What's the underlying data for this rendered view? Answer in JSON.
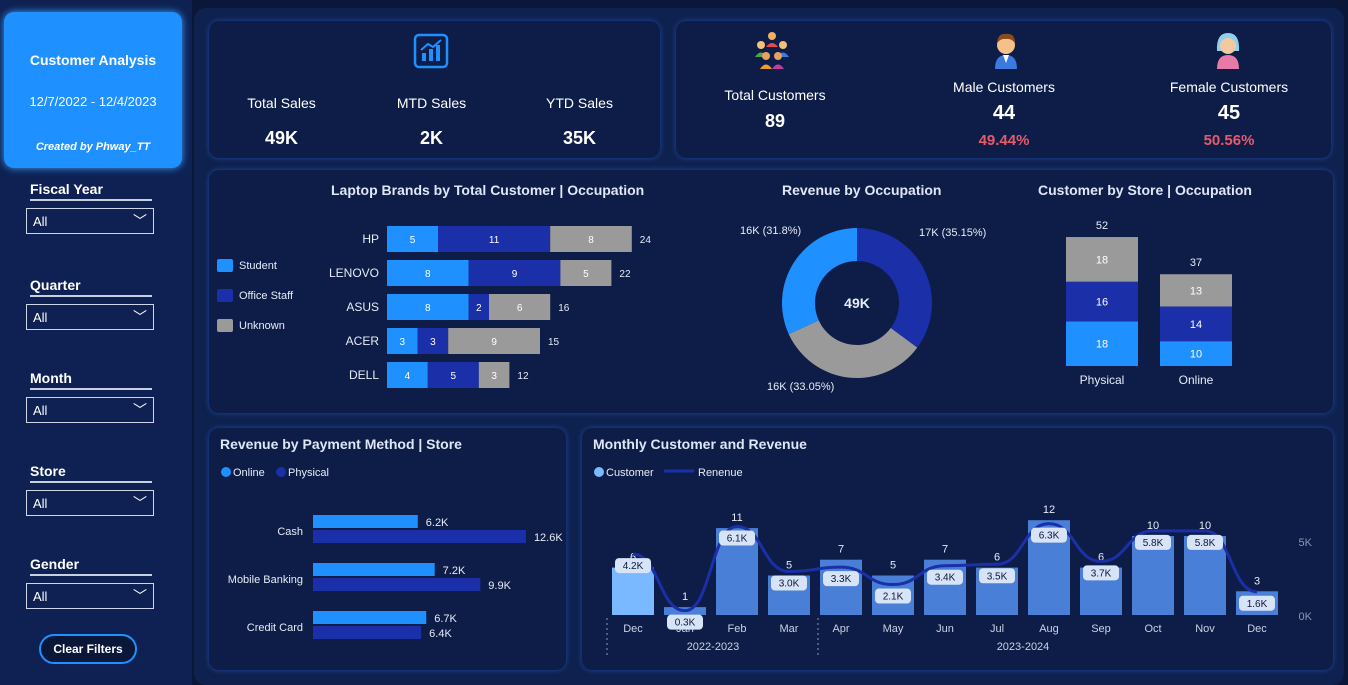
{
  "sidebar": {
    "title": "Customer Analysis",
    "date_range": "12/7/2022 - 12/4/2023",
    "created_by": "Created by Phway_TT",
    "filters": [
      {
        "label": "Fiscal Year",
        "value": "All"
      },
      {
        "label": "Quarter",
        "value": "All"
      },
      {
        "label": "Month",
        "value": "All"
      },
      {
        "label": "Store",
        "value": "All"
      },
      {
        "label": "Gender",
        "value": "All"
      }
    ],
    "clear_label": "Clear Filters"
  },
  "kpi_sales": {
    "icon": "growth-chart-icon",
    "total_label": "Total Sales",
    "total_value": "49K",
    "mtd_label": "MTD Sales",
    "mtd_value": "2K",
    "ytd_label": "YTD Sales",
    "ytd_value": "35K"
  },
  "kpi_customers": {
    "total_label": "Total Customers",
    "total_value": "89",
    "male_label": "Male Customers",
    "male_value": "44",
    "male_pct": "49.44%",
    "female_label": "Female Customers",
    "female_value": "45",
    "female_pct": "50.56%",
    "colors": {
      "pct": "#e85a6a"
    }
  },
  "colors": {
    "student": "#1e90ff",
    "office": "#1a2fa8",
    "unknown": "#9a9a9a",
    "accent": "#1e90ff"
  },
  "chart_data": [
    {
      "type": "bar",
      "title": "Laptop Brands by Total Customer | Occupation",
      "categories": [
        "HP",
        "LENOVO",
        "ASUS",
        "ACER",
        "DELL"
      ],
      "series": [
        {
          "name": "Student",
          "values": [
            5,
            8,
            8,
            3,
            4
          ]
        },
        {
          "name": "Office Staff",
          "values": [
            11,
            9,
            2,
            3,
            5
          ]
        },
        {
          "name": "Unknown",
          "values": [
            8,
            5,
            6,
            9,
            3
          ]
        }
      ],
      "totals": [
        24,
        22,
        16,
        15,
        12
      ],
      "legend": "left"
    },
    {
      "type": "pie",
      "title": "Revenue by Occupation",
      "center_label": "49K",
      "slices": [
        {
          "label": "17K (35.15%)",
          "value": 35.15,
          "color": "#1a2fa8"
        },
        {
          "label": "16K (33.05%)",
          "value": 33.05,
          "color": "#9a9a9a"
        },
        {
          "label": "16K (31.8%)",
          "value": 31.8,
          "color": "#1e90ff"
        }
      ]
    },
    {
      "type": "bar",
      "title": "Customer by Store | Occupation",
      "categories": [
        "Physical",
        "Online"
      ],
      "series": [
        {
          "name": "Student",
          "values": [
            18,
            10
          ]
        },
        {
          "name": "Office Staff",
          "values": [
            16,
            14
          ]
        },
        {
          "name": "Unknown",
          "values": [
            18,
            13
          ]
        }
      ],
      "totals": [
        52,
        37
      ]
    },
    {
      "type": "bar",
      "title": "Revenue by Payment Method | Store",
      "categories": [
        "Cash",
        "Mobile Banking",
        "Credit Card"
      ],
      "series": [
        {
          "name": "Online",
          "values": [
            6.2,
            7.2,
            6.7
          ],
          "labels": [
            "6.2K",
            "7.2K",
            "6.7K"
          ]
        },
        {
          "name": "Physical",
          "values": [
            12.6,
            9.9,
            6.4
          ],
          "labels": [
            "12.6K",
            "9.9K",
            "6.4K"
          ]
        }
      ],
      "legend": "top-left"
    },
    {
      "type": "bar",
      "title": "Monthly Customer and Revenue",
      "categories": [
        "Dec",
        "Jan",
        "Feb",
        "Mar",
        "Apr",
        "May",
        "Jun",
        "Jul",
        "Aug",
        "Sep",
        "Oct",
        "Nov",
        "Dec"
      ],
      "groups": [
        {
          "label": "2022-2023"
        },
        {
          "label": "2023-2024"
        }
      ],
      "series": [
        {
          "name": "Customer",
          "values": [
            6,
            1,
            11,
            5,
            7,
            5,
            7,
            6,
            12,
            6,
            10,
            10,
            3
          ]
        },
        {
          "name": "Renenue",
          "values": [
            4.2,
            0.3,
            6.1,
            3.0,
            3.3,
            2.1,
            3.4,
            3.5,
            6.3,
            3.7,
            5.8,
            5.8,
            1.6
          ],
          "labels": [
            "4.2K",
            "0.3K",
            "6.1K",
            "3.0K",
            "3.3K",
            "2.1K",
            "3.4K",
            "3.5K",
            "6.3K",
            "3.7K",
            "5.8K",
            "5.8K",
            "1.6K"
          ]
        }
      ],
      "y2_ticks": [
        "5K",
        "0K"
      ],
      "legend": "top-left"
    }
  ]
}
